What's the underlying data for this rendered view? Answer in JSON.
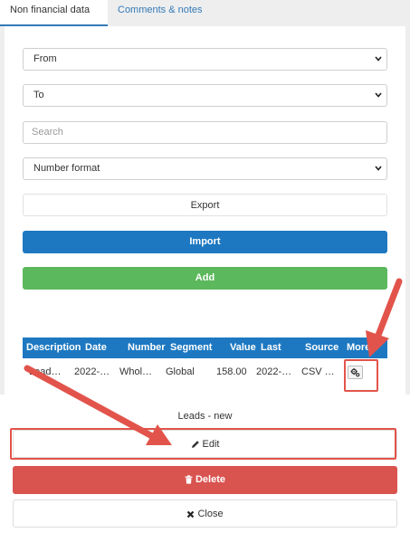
{
  "tabs": [
    {
      "label": "Non financial data",
      "active": true
    },
    {
      "label": "Comments & notes",
      "active": false
    }
  ],
  "filters": {
    "from": "From",
    "to": "To",
    "search_placeholder": "Search",
    "number_format": "Number format"
  },
  "buttons": {
    "export": "Export",
    "import": "Import",
    "add": "Add"
  },
  "table": {
    "columns": [
      "Description",
      "Date",
      "Number",
      "Segment",
      "Value",
      "Last",
      "Source",
      "More"
    ],
    "rows": [
      [
        "Lead…",
        "2022-…",
        "Whol…",
        "Global",
        "158.00",
        "2022-…",
        "CSV …"
      ]
    ]
  },
  "sheet": {
    "title": "Leads - new",
    "edit": "Edit",
    "delete": "Delete",
    "close": "Close"
  },
  "colors": {
    "primary": "#1d78c1",
    "success": "#5cb85c",
    "danger": "#d9534f",
    "annotation": "#e2544b"
  }
}
